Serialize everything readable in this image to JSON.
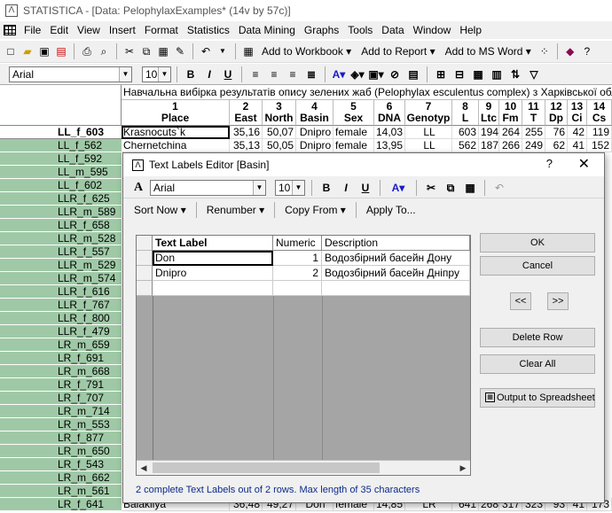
{
  "window": {
    "title": "STATISTICA - [Data: PelophylaxExamples* (14v by 57c)]",
    "menu": [
      "File",
      "Edit",
      "View",
      "Insert",
      "Format",
      "Statistics",
      "Data Mining",
      "Graphs",
      "Tools",
      "Data",
      "Window",
      "Help"
    ],
    "toolbar": {
      "add_workbook": "Add to Workbook",
      "add_report": "Add to Report",
      "add_msword": "Add to MS Word"
    },
    "format_bar": {
      "font": "Arial",
      "size": "10"
    }
  },
  "sheet": {
    "title_row": "Навчальна вибірка результатів опису зелених жаб (Pelophylax esculentus complex) з Харківської області",
    "columns": [
      {
        "num": "1",
        "name": "Place"
      },
      {
        "num": "2",
        "name": "East"
      },
      {
        "num": "3",
        "name": "North"
      },
      {
        "num": "4",
        "name": "Basin"
      },
      {
        "num": "5",
        "name": "Sex"
      },
      {
        "num": "6",
        "name": "DNA"
      },
      {
        "num": "7",
        "name": "Genotyp"
      },
      {
        "num": "8",
        "name": "L"
      },
      {
        "num": "9",
        "name": "Ltc"
      },
      {
        "num": "10",
        "name": "Fm"
      },
      {
        "num": "11",
        "name": "T"
      },
      {
        "num": "12",
        "name": "Dp"
      },
      {
        "num": "13",
        "name": "Ci"
      },
      {
        "num": "14",
        "name": "Cs"
      }
    ],
    "rows": [
      {
        "label": "LL_f_603",
        "cells": [
          "Krasnocuts`k",
          "35,16",
          "50,07",
          "Dnipro",
          "female",
          "14,03",
          "LL",
          "603",
          "194",
          "264",
          "255",
          "76",
          "42",
          "119"
        ]
      },
      {
        "label": "LL_f_562",
        "cells": [
          "Chernetchina",
          "35,13",
          "50,05",
          "Dnipro",
          "female",
          "13,95",
          "LL",
          "562",
          "187",
          "266",
          "249",
          "62",
          "41",
          "152"
        ]
      },
      {
        "label": "LL_f_592",
        "cells": [
          "C"
        ]
      },
      {
        "label": "LL_m_595",
        "cells": [
          "C"
        ]
      },
      {
        "label": "LL_f_602",
        "cells": [
          "C"
        ]
      },
      {
        "label": "LLR_f_625",
        "cells": [
          "L"
        ]
      },
      {
        "label": "LLR_m_589",
        "cells": [
          "D"
        ]
      },
      {
        "label": "LLR_f_658",
        "cells": [
          "L"
        ]
      },
      {
        "label": "LLR_m_528",
        "cells": [
          "K"
        ]
      },
      {
        "label": "LLR_f_557",
        "cells": [
          "K"
        ]
      },
      {
        "label": "LLR_m_529",
        "cells": [
          "V"
        ]
      },
      {
        "label": "LLR_m_574",
        "cells": [
          "V"
        ]
      },
      {
        "label": "LLR_f_616",
        "cells": [
          "V"
        ]
      },
      {
        "label": "LLR_f_767",
        "cells": [
          "Z"
        ]
      },
      {
        "label": "LLR_f_800",
        "cells": [
          "Z"
        ]
      },
      {
        "label": "LLR_f_479",
        "cells": [
          "C"
        ]
      },
      {
        "label": "LR_m_659",
        "cells": [
          "S"
        ]
      },
      {
        "label": "LR_f_691",
        "cells": [
          "S"
        ]
      },
      {
        "label": "LR_m_668",
        "cells": [
          "L"
        ]
      },
      {
        "label": "LR_f_791",
        "cells": [
          "C"
        ]
      },
      {
        "label": "LR_f_707",
        "cells": [
          "D"
        ]
      },
      {
        "label": "LR_m_714",
        "cells": [
          "D"
        ]
      },
      {
        "label": "LR_m_553",
        "cells": [
          "V"
        ]
      },
      {
        "label": "LR_f_877",
        "cells": [
          "S"
        ]
      },
      {
        "label": "LR_m_650",
        "cells": [
          "K"
        ]
      },
      {
        "label": "LR_f_543",
        "cells": [
          "V"
        ]
      },
      {
        "label": "LR_m_662",
        "cells": [
          "P"
        ]
      },
      {
        "label": "LR_m_561",
        "cells": [
          "B"
        ]
      },
      {
        "label": "LR_f_641",
        "cells": [
          "Balakliya",
          "36,48",
          "49,27",
          "Don",
          "female",
          "14,85",
          "LR",
          "641",
          "268",
          "317",
          "323",
          "93",
          "41",
          "173"
        ]
      }
    ]
  },
  "dialog": {
    "title": "Text Labels Editor [Basin]",
    "help": "?",
    "close": "✕",
    "font": "Arial",
    "size": "10",
    "menu": {
      "sort_now": "Sort Now",
      "renumber": "Renumber",
      "copy_from": "Copy From",
      "apply_to": "Apply To..."
    },
    "grid": {
      "headers": [
        "Text Label",
        "Numeric",
        "Description"
      ],
      "rows": [
        {
          "label": "Don",
          "numeric": "1",
          "description": "Водозбірний басейн Дону"
        },
        {
          "label": "Dnipro",
          "numeric": "2",
          "description": "Водозбірний басейн Дніпру"
        }
      ]
    },
    "buttons": {
      "ok": "OK",
      "cancel": "Cancel",
      "prev": "<<",
      "next": ">>",
      "delete_row": "Delete Row",
      "clear_all": "Clear All",
      "output": "Output to Spreadsheet"
    },
    "status": "2 complete Text Labels out of 2 rows. Max length of 35 characters"
  }
}
